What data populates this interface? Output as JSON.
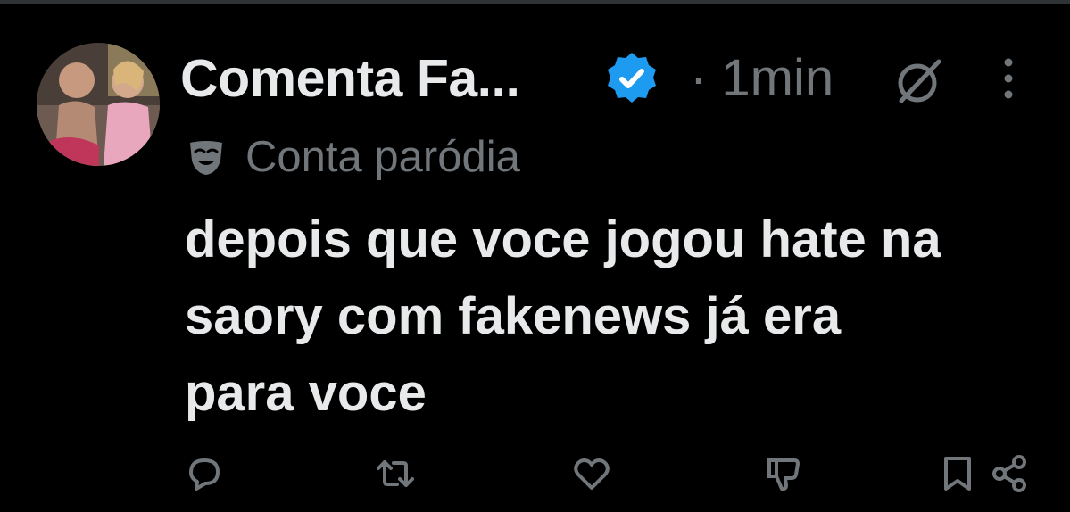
{
  "post": {
    "author_name": "Comenta Fa...",
    "time": "· 1min",
    "parody_label": "Conta paródia",
    "text": "depois que voce jogou hate na\nsaory com fakenews já era\npara voce"
  },
  "icons": {
    "verified": "verified-badge-icon",
    "grok": "grok-icon",
    "more": "more-options-icon",
    "parody": "theater-mask-icon",
    "actions": [
      "reply-icon",
      "repost-icon",
      "like-icon",
      "downvote-icon",
      "bookmark-icon",
      "share-icon"
    ]
  },
  "colors": {
    "background": "#000000",
    "text": "#e7e9ea",
    "secondary": "#71767b",
    "verified": "#1d9bf0"
  }
}
